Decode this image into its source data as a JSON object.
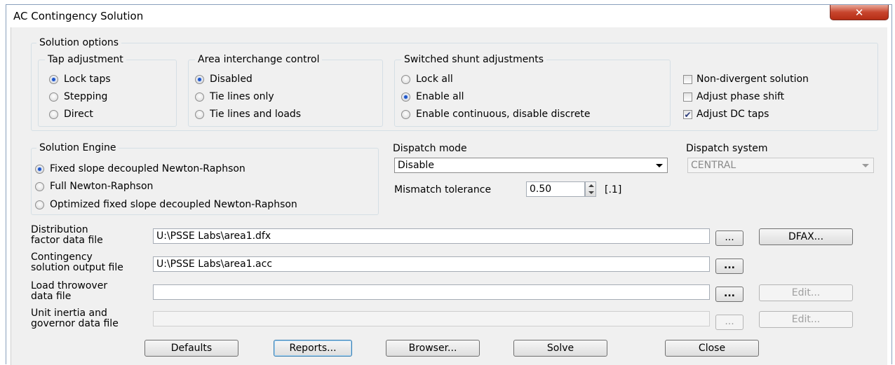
{
  "window": {
    "title": "AC Contingency Solution",
    "close_glyph": "✕"
  },
  "solution_options": {
    "legend": "Solution options",
    "tap_adjustment": {
      "legend": "Tap adjustment",
      "options": [
        "Lock taps",
        "Stepping",
        "Direct"
      ],
      "selected": "Lock taps"
    },
    "area_interchange": {
      "legend": "Area interchange control",
      "options": [
        "Disabled",
        "Tie lines only",
        "Tie lines and loads"
      ],
      "selected": "Disabled"
    },
    "switched_shunt": {
      "legend": "Switched shunt adjustments",
      "options": [
        "Lock all",
        "Enable all",
        "Enable continuous, disable discrete"
      ],
      "selected": "Enable all"
    },
    "checks": [
      {
        "label": "Non-divergent solution",
        "checked": false
      },
      {
        "label": "Adjust phase shift",
        "checked": false
      },
      {
        "label": "Adjust DC taps",
        "checked": true
      }
    ]
  },
  "solution_engine": {
    "legend": "Solution Engine",
    "options": [
      "Fixed slope decoupled Newton-Raphson",
      "Full Newton-Raphson",
      "Optimized fixed slope decoupled Newton-Raphson"
    ],
    "selected": "Fixed slope decoupled Newton-Raphson"
  },
  "dispatch": {
    "mode_label": "Dispatch mode",
    "mode_value": "Disable",
    "system_label": "Dispatch system",
    "system_value": "CENTRAL",
    "mismatch_label": "Mismatch tolerance",
    "mismatch_value": "0.50",
    "mismatch_default": "[.1]"
  },
  "files": {
    "dfx": {
      "label_line1": "Distribution",
      "label_line2": "factor data file",
      "value": "U:\\PSSE Labs\\area1.dfx",
      "browse": "...",
      "action": "DFAX..."
    },
    "acc": {
      "label_line1": "Contingency",
      "label_line2": "solution output file",
      "value": "U:\\PSSE Labs\\area1.acc",
      "browse": "..."
    },
    "thrower": {
      "label_line1": "Load throwover",
      "label_line2": "data file",
      "value": "",
      "browse": "...",
      "action": "Edit..."
    },
    "inertia": {
      "label_line1": "Unit inertia and",
      "label_line2": "governor data file",
      "value": "",
      "browse": "...",
      "action": "Edit..."
    }
  },
  "buttons": {
    "defaults": "Defaults",
    "reports": "Reports...",
    "browser": "Browser...",
    "solve": "Solve",
    "close": "Close"
  },
  "colors": {
    "selected_radio": "#1f56c7",
    "close_button": "#c8452d",
    "group_border": "#d5dfe5"
  }
}
